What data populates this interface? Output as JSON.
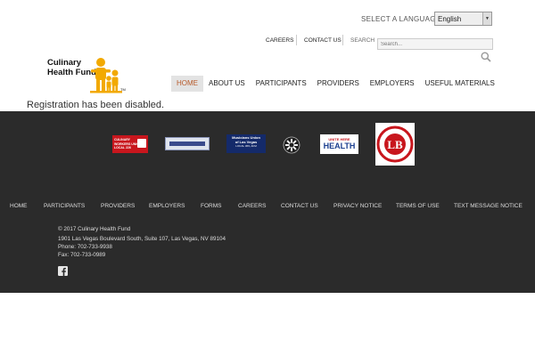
{
  "header": {
    "language_label": "SELECT A LANGUAGE",
    "language_value": "English",
    "util_links": [
      "CAREERS",
      "CONTACT US"
    ],
    "search_label": "SEARCH",
    "search_placeholder": "Search..."
  },
  "logo": {
    "line1": "Culinary",
    "line2": "Health Fund",
    "tm": "TM"
  },
  "nav": {
    "items": [
      "HOME",
      "ABOUT US",
      "PARTICIPANTS",
      "PROVIDERS",
      "EMPLOYERS",
      "USEFUL MATERIALS"
    ]
  },
  "main": {
    "message": "Registration has been disabled."
  },
  "partners": {
    "culinary": {
      "line1": "CULINARY",
      "line2": "WORKERS UNION",
      "line3": "LOCAL 226"
    },
    "musicians": {
      "line1": "Musicians Union",
      "line2": "of Las Vegas",
      "line3": "LOCAL 369, AFM"
    },
    "unitehere": {
      "line1": "UNITE HERE",
      "line2": "HEALTH"
    },
    "bartenders": {
      "mono": "LB"
    }
  },
  "footer": {
    "nav": [
      "HOME",
      "PARTICIPANTS",
      "PROVIDERS",
      "EMPLOYERS",
      "FORMS",
      "CAREERS",
      "CONTACT US",
      "PRIVACY NOTICE",
      "TERMS OF USE",
      "TEXT MESSAGE NOTICE"
    ],
    "copyright": "© 2017 Culinary Health Fund",
    "address": "1901 Las Vegas Boulevard South, Suite 107, Las Vegas, NV 89104",
    "phone": "Phone: 702-733-9938",
    "fax": "Fax: 702-733-0989"
  },
  "colors": {
    "footer_bg": "#2b2b2b",
    "active_nav": "#b75a2a",
    "logo_figures": "#f2a900"
  }
}
